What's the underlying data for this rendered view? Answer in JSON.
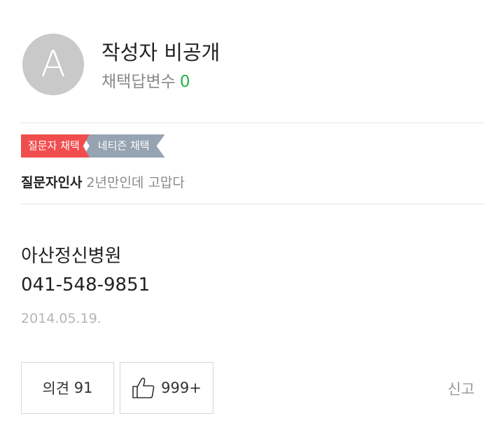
{
  "author": {
    "avatar_letter": "A",
    "name": "작성자 비공개",
    "answer_count_label": "채택답변수",
    "answer_count": "0"
  },
  "badges": {
    "questioner": "질문자 채택",
    "netizen": "네티즌 채택"
  },
  "greeting": {
    "label": "질문자인사",
    "text": "2년만인데 고맙다"
  },
  "answer": {
    "line1": "아산정신병원",
    "line2": "041-548-9851",
    "date": "2014.05.19."
  },
  "actions": {
    "comment_label": "의견",
    "comment_count": "91",
    "like_icon": "thumbs-up-icon",
    "like_count": "999+",
    "report_label": "신고"
  },
  "colors": {
    "badge_questioner": "#f04e4e",
    "badge_netizen": "#95a3b2",
    "answer_count": "#21b34b"
  }
}
